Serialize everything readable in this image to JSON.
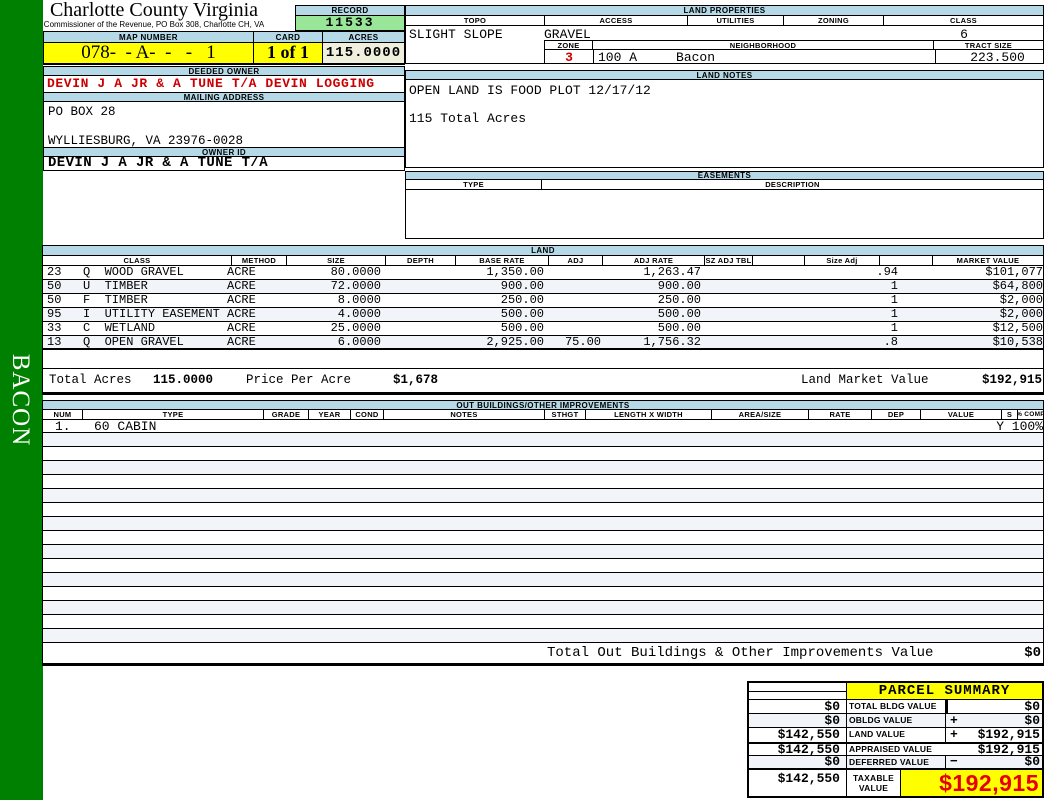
{
  "sidebar": {
    "vertical_label": "BACON"
  },
  "header": {
    "title": "Charlotte County Virginia",
    "subtitle": "Commissioner of the Revenue, PO Box 308, Charlotte CH, VA",
    "record_label": "RECORD",
    "record_value": "11533",
    "map_number_label": "MAP NUMBER",
    "map_number_value": "078-  - A-  -   -   1",
    "card_label": "CARD",
    "card_value": "1 of 1",
    "acres_label": "ACRES",
    "acres_value": "115.0000"
  },
  "owner": {
    "deeded_owner_label": "DEEDED OWNER",
    "deeded_owner": "DEVIN J A JR & A TUNE T/A DEVIN LOGGING",
    "mailing_address_label": "MAILING ADDRESS",
    "address_line1": "PO BOX 28",
    "address_line2": "WYLLIESBURG, VA 23976-0028",
    "owner_id_label": "OWNER ID",
    "owner_id": "DEVIN J A JR & A TUNE T/A"
  },
  "land_properties": {
    "title": "LAND PROPERTIES",
    "topo_label": "TOPO",
    "access_label": "ACCESS",
    "utilities_label": "UTILITIES",
    "zoning_label": "ZONING",
    "class_label": "CLASS",
    "topo": "SLIGHT SLOPE",
    "access": "GRAVEL",
    "utilities": "",
    "zoning": "",
    "class": "6",
    "zone_label": "ZONE",
    "neighborhood_label": "NEIGHBORHOOD",
    "tract_size_label": "TRACT SIZE",
    "zone": "3",
    "neighborhood": "100 A     Bacon",
    "tract_size": "223.500"
  },
  "land_notes": {
    "title": "LAND NOTES",
    "line1": "OPEN LAND IS FOOD PLOT 12/17/12",
    "line2": "115 Total Acres"
  },
  "easements": {
    "title": "EASEMENTS",
    "type_label": "TYPE",
    "description_label": "DESCRIPTION"
  },
  "land": {
    "title": "LAND",
    "headers": [
      "CLASS",
      "METHOD",
      "SIZE",
      "DEPTH",
      "BASE RATE",
      "ADJ",
      "ADJ RATE",
      "SZ ADJ TBL",
      "",
      "Size Adj",
      "",
      "MARKET VALUE"
    ],
    "rows": [
      {
        "class": "23   Q  WOOD GRAVEL",
        "method": "ACRE",
        "size": "80.0000",
        "base_rate": "1,350.00",
        "adj": "",
        "adj_rate": "1,263.47",
        "size_adj": ".94",
        "market_value": "$101,077"
      },
      {
        "class": "50   U  TIMBER",
        "method": "ACRE",
        "size": "72.0000",
        "base_rate": "900.00",
        "adj": "",
        "adj_rate": "900.00",
        "size_adj": "1",
        "market_value": "$64,800"
      },
      {
        "class": "50   F  TIMBER",
        "method": "ACRE",
        "size": "8.0000",
        "base_rate": "250.00",
        "adj": "",
        "adj_rate": "250.00",
        "size_adj": "1",
        "market_value": "$2,000"
      },
      {
        "class": "95   I  UTILITY EASEMENT",
        "method": "ACRE",
        "size": "4.0000",
        "base_rate": "500.00",
        "adj": "",
        "adj_rate": "500.00",
        "size_adj": "1",
        "market_value": "$2,000"
      },
      {
        "class": "33   C  WETLAND",
        "method": "ACRE",
        "size": "25.0000",
        "base_rate": "500.00",
        "adj": "",
        "adj_rate": "500.00",
        "size_adj": "1",
        "market_value": "$12,500"
      },
      {
        "class": "13   Q  OPEN GRAVEL",
        "method": "ACRE",
        "size": "6.0000",
        "base_rate": "2,925.00",
        "adj": "75.00",
        "adj_rate": "1,756.32",
        "size_adj": ".8",
        "market_value": "$10,538"
      }
    ],
    "total_acres_label": "Total Acres",
    "total_acres": "115.0000",
    "price_per_acre_label": "Price Per Acre",
    "price_per_acre": "$1,678",
    "land_market_value_label": "Land Market Value",
    "land_market_value": "$192,915"
  },
  "out_buildings": {
    "title": "OUT BUILDINGS/OTHER IMPROVEMENTS",
    "headers": [
      "NUM",
      "TYPE",
      "GRADE",
      "YEAR",
      "COND",
      "NOTES",
      "STHGT",
      "LENGTH X WIDTH",
      "AREA/SIZE",
      "RATE",
      "DEP",
      "VALUE",
      "S",
      "% COMP"
    ],
    "rows": [
      {
        "num": "1.",
        "type": "60 CABIN",
        "s_comp": "Y 100%"
      }
    ],
    "total_label": "Total Out Buildings & Other Improvements Value",
    "total_value": "$0"
  },
  "parcel_summary": {
    "title": "PARCEL SUMMARY",
    "rows": [
      {
        "prior": "$0",
        "label": "TOTAL BLDG VALUE",
        "sign": "",
        "value": "$0"
      },
      {
        "prior": "$0",
        "label": "OBLDG VALUE",
        "sign": "+",
        "value": "$0"
      },
      {
        "prior": "$142,550",
        "label": "LAND VALUE",
        "sign": "+",
        "value": "$192,915"
      },
      {
        "prior": "$142,550",
        "label": "APPRAISED VALUE",
        "sign": "",
        "value": "$192,915"
      },
      {
        "prior": "$0",
        "label": "DEFERRED VALUE",
        "sign": "−",
        "value": "$0"
      }
    ],
    "taxable": {
      "prior": "$142,550",
      "label": "TAXABLE\nVALUE",
      "value": "$192,915"
    }
  },
  "colors": {
    "sidebar_green": "#008000",
    "section_bar_blue": "#b6d9e8",
    "highlight_yellow": "#ffff00",
    "record_green": "#99e699",
    "acres_cream": "#f0eedc",
    "owner_red": "#cc0000",
    "taxable_red": "#e60000"
  }
}
